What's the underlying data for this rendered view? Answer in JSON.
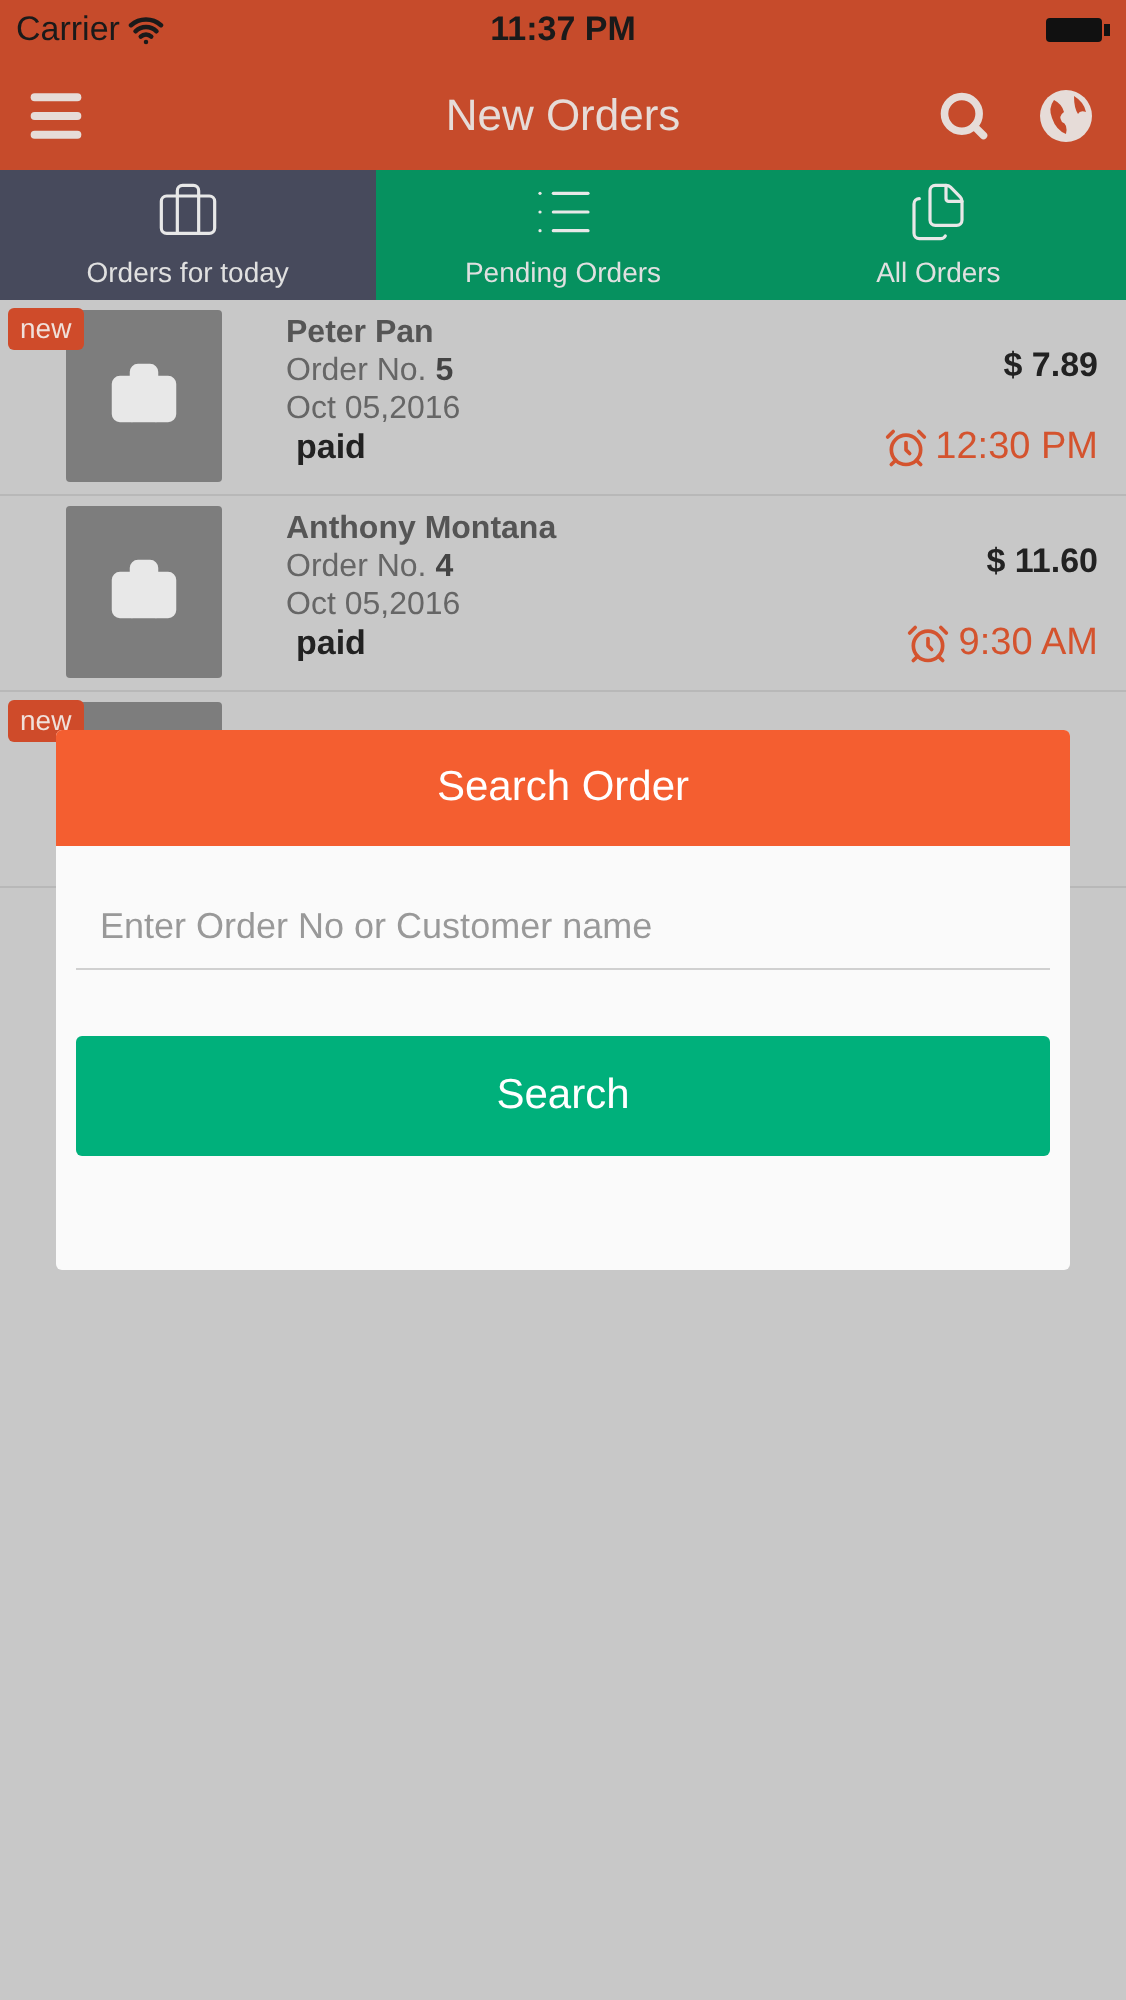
{
  "status_bar": {
    "carrier": "Carrier",
    "time": "11:37 PM"
  },
  "nav": {
    "title": "New Orders"
  },
  "tabs": [
    {
      "label": "Orders for today",
      "selected": true,
      "kind": "briefcase"
    },
    {
      "label": "Pending Orders",
      "selected": false,
      "kind": "list"
    },
    {
      "label": "All Orders",
      "selected": false,
      "kind": "pages"
    }
  ],
  "orders": [
    {
      "is_new": true,
      "badge": "new",
      "customer": "Peter Pan",
      "order_label": "Order No.",
      "order_no": "5",
      "date": "Oct 05,2016",
      "payment": "paid",
      "price": "$ 7.89",
      "time": "12:30 PM"
    },
    {
      "is_new": false,
      "customer": "Anthony Montana",
      "order_label": "Order No.",
      "order_no": "4",
      "date": "Oct 05,2016",
      "payment": "paid",
      "price": "$ 11.60",
      "time": "9:30 AM"
    },
    {
      "is_new": true,
      "badge": "new"
    }
  ],
  "dialog": {
    "title": "Search Order",
    "search_field": {
      "placeholder": "Enter Order No or Customer name"
    },
    "button": "Search"
  }
}
